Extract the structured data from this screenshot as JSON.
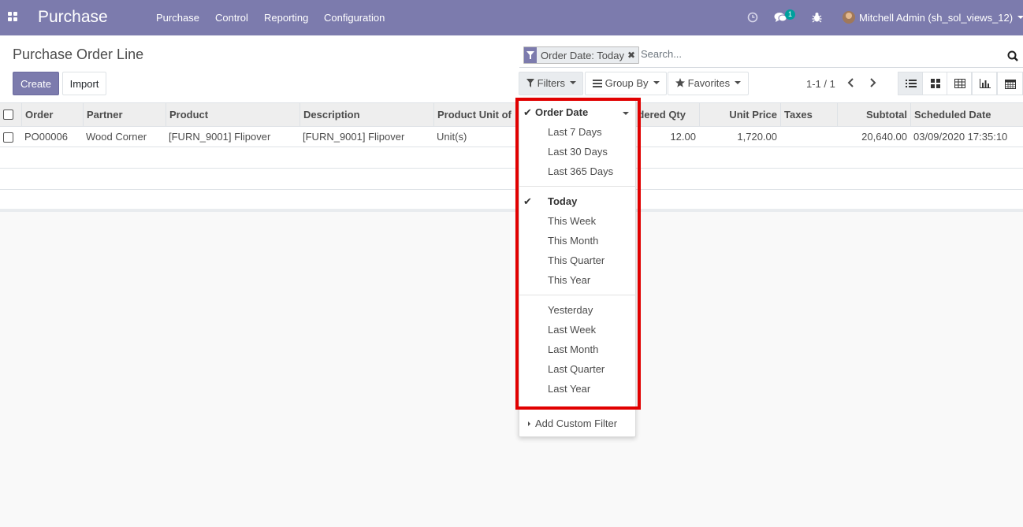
{
  "navbar": {
    "brand": "Purchase",
    "menu": [
      "Purchase",
      "Control",
      "Reporting",
      "Configuration"
    ],
    "messages_badge": "1",
    "user": "Mitchell Admin (sh_sol_views_12)"
  },
  "control_panel": {
    "title": "Purchase Order Line",
    "create_label": "Create",
    "import_label": "Import",
    "search": {
      "facet_label": "Order Date: Today",
      "facet_remove": "✖",
      "placeholder": "Search..."
    },
    "filters_label": "Filters",
    "groupby_label": "Group By",
    "favorites_label": "Favorites",
    "pager": "1-1 / 1"
  },
  "table": {
    "columns": [
      "Order",
      "Partner",
      "Product",
      "Description",
      "Product Unit of",
      "dered Qty",
      "Unit Price",
      "Taxes",
      "Subtotal",
      "Scheduled Date"
    ],
    "rows": [
      {
        "order": "PO00006",
        "partner": "Wood Corner",
        "product": "[FURN_9001] Flipover",
        "description": "[FURN_9001] Flipover",
        "uom": "Unit(s)",
        "qty": "12.00",
        "unit_price": "1,720.00",
        "taxes": "",
        "subtotal": "20,640.00",
        "scheduled_date": "03/09/2020 17:35:10"
      }
    ]
  },
  "filters_dropdown": {
    "order_date": "Order Date",
    "group1": [
      "Last 7 Days",
      "Last 30 Days",
      "Last 365 Days"
    ],
    "group2": [
      "Today",
      "This Week",
      "This Month",
      "This Quarter",
      "This Year"
    ],
    "group3": [
      "Yesterday",
      "Last Week",
      "Last Month",
      "Last Quarter",
      "Last Year"
    ],
    "add_custom": "Add Custom Filter"
  },
  "colors": {
    "navbar": "#7c7bad",
    "highlight": "#e10000",
    "badge": "#00a09d"
  }
}
